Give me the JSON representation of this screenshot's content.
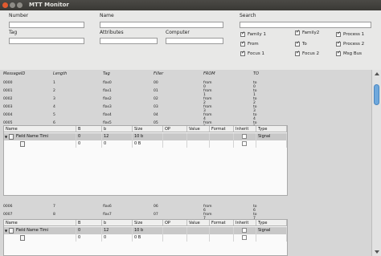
{
  "window": {
    "title": "MTT Monitor"
  },
  "filters": {
    "number_label": "Number",
    "name_label": "Name",
    "search_label": "Search",
    "tag_label": "Tag",
    "attributes_label": "Attributes",
    "computer_label": "Computer",
    "checkboxes": [
      {
        "label": "Family 1",
        "checked": true
      },
      {
        "label": "Family2",
        "checked": true
      },
      {
        "label": "Process 1",
        "checked": true
      },
      {
        "label": "From",
        "checked": true
      },
      {
        "label": "To",
        "checked": true
      },
      {
        "label": "Process 2",
        "checked": true
      },
      {
        "label": "Focus 1",
        "checked": true
      },
      {
        "label": "Focus 2",
        "checked": true
      },
      {
        "label": "Msg Bus",
        "checked": true
      }
    ]
  },
  "messages": {
    "columns": [
      "MessageID",
      "Length",
      "Tag",
      "Filler",
      "FROM",
      "TO"
    ],
    "rows_a": [
      [
        "0000",
        "1",
        "flas0",
        "00",
        "from 0",
        "to 0"
      ],
      [
        "0001",
        "2",
        "flas1",
        "01",
        "from 1",
        "to 1"
      ],
      [
        "0002",
        "3",
        "flas2",
        "02",
        "from 2",
        "to 2"
      ],
      [
        "0003",
        "4",
        "flas3",
        "03",
        "from 3",
        "to 3"
      ],
      [
        "0004",
        "5",
        "flas4",
        "04",
        "from 4",
        "to 4"
      ],
      [
        "0005",
        "6",
        "flas5",
        "05",
        "from 5",
        "to 5"
      ]
    ],
    "rows_b": [
      [
        "0006",
        "7",
        "flas6",
        "06",
        "from 6",
        "to 6"
      ],
      [
        "0007",
        "8",
        "flas7",
        "07",
        "from 7",
        "to 7"
      ]
    ]
  },
  "field_table": {
    "columns": [
      "Name",
      "B",
      "b",
      "Size",
      "OP",
      "Value",
      "Format",
      "Inherit",
      "Type"
    ],
    "rows": [
      {
        "name": "Field Name Timi",
        "B": "0",
        "b": "12",
        "size": "10 b",
        "type": "Signal",
        "inherit": false
      },
      {
        "name": "",
        "B": "0",
        "b": "0",
        "size": "0 B",
        "type": "",
        "inherit": false
      }
    ]
  }
}
